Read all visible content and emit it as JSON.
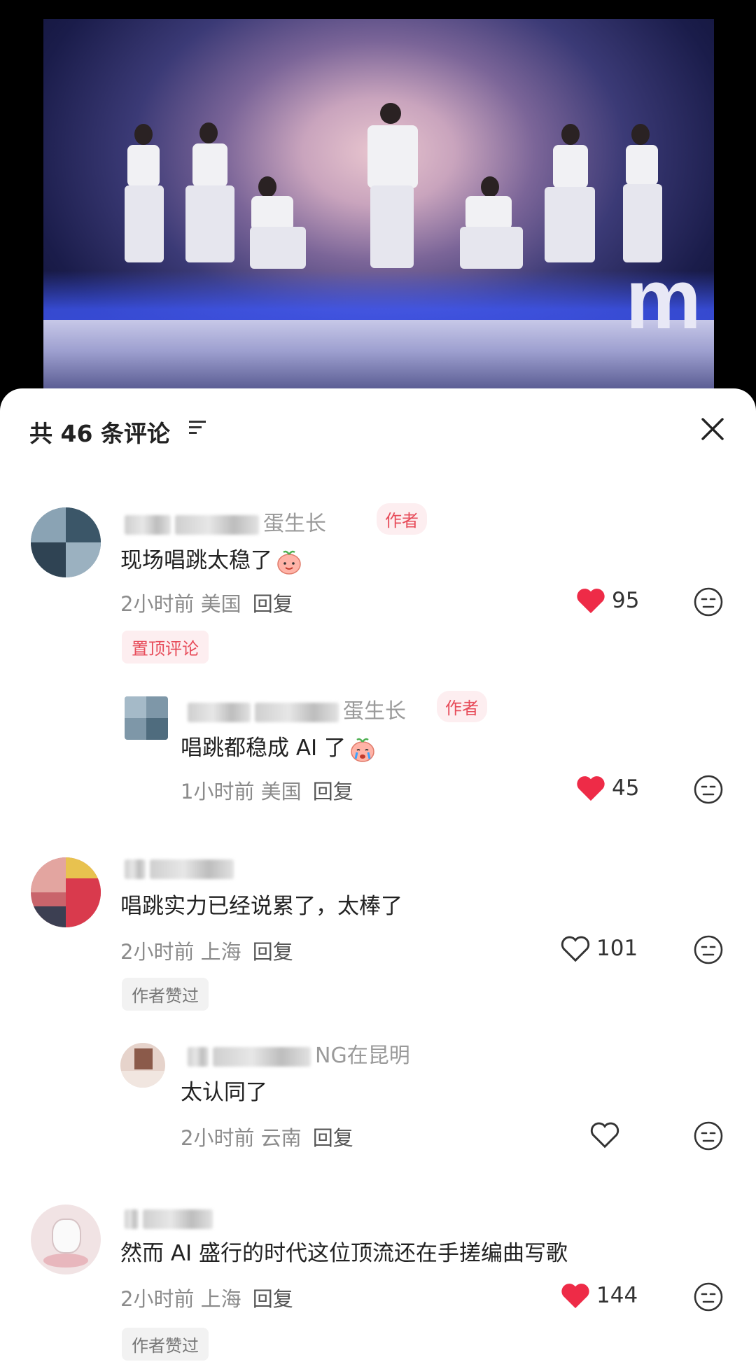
{
  "video": {
    "stage_logo": "m"
  },
  "sheet": {
    "comment_count_label": "共 46 条评论",
    "sort_icon": "sort-lines-icon",
    "close_icon": "close-x-icon"
  },
  "comments": [
    {
      "name_suffix": "蛋生长",
      "badge": "作者",
      "text": "现场唱跳太稳了",
      "emoji": "smiling-peach-emoji",
      "time": "2小时前",
      "location": "美国",
      "reply_label": "回复",
      "likes": "95",
      "liked": true,
      "tag": "置顶评论",
      "replies": [
        {
          "name_suffix": "蛋生长",
          "badge": "作者",
          "text": "唱跳都稳成 AI 了",
          "emoji": "crying-peach-emoji",
          "time": "1小时前",
          "location": "美国",
          "reply_label": "回复",
          "likes": "45",
          "liked": true
        }
      ]
    },
    {
      "name_suffix": "",
      "text": "唱跳实力已经说累了，太棒了",
      "time": "2小时前",
      "location": "上海",
      "reply_label": "回复",
      "likes": "101",
      "liked": false,
      "tag": "作者赞过",
      "replies": [
        {
          "name_suffix": "NG在昆明",
          "text": "太认同了",
          "time": "2小时前",
          "location": "云南",
          "reply_label": "回复",
          "likes": "",
          "liked": false
        }
      ]
    },
    {
      "name_suffix": "",
      "text": "然而 AI 盛行的时代这位顶流还在手搓编曲写歌",
      "time": "2小时前",
      "location": "上海",
      "reply_label": "回复",
      "likes": "144",
      "liked": true,
      "tag": "作者赞过"
    }
  ],
  "colors": {
    "accent_red": "#e74c5a",
    "heart_red": "#ee2b47",
    "muted_text": "#8b8b8b"
  }
}
